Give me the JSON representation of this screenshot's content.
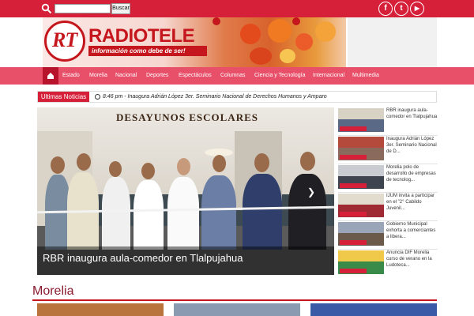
{
  "topbar": {
    "search_button_label": "Buscar",
    "search_value": "",
    "social": [
      {
        "icon": "facebook-icon",
        "glyph": "f"
      },
      {
        "icon": "twitter-icon",
        "glyph": "t"
      },
      {
        "icon": "youtube-icon",
        "glyph": "▶"
      }
    ]
  },
  "header": {
    "logo_initials": "RT",
    "logo_name": "RADIOTELE",
    "logo_tagline": "información como debe de ser!"
  },
  "nav": {
    "home_icon": "home-icon",
    "items": [
      "Estado",
      "Morelia",
      "Nacional",
      "Deportes",
      "Espectáculos",
      "Columnas",
      "Ciencia y Tecnología",
      "Internacional",
      "Multimedia"
    ]
  },
  "ticker": {
    "label": "Ultimas Noticias",
    "time": "8:46 pm",
    "separator": "-",
    "headline": "Inaugura Adrián López 3er. Seminario Nacional de Derechos Humanos y Amparo"
  },
  "hero": {
    "sign_text": "DESAYUNOS ESCOLARES",
    "caption": "RBR inaugura aula-comedor en Tlalpujahua",
    "next_icon": "chevron-right-icon"
  },
  "side_news": [
    {
      "title": "RBR inaugura aula-comedor en Tlalpujahua"
    },
    {
      "title": "Inaugura Adrián López 3er. Seminario Nacional de D..."
    },
    {
      "title": "Morelia polo de desarrollo de empresas de tecnolog..."
    },
    {
      "title": "IJUM invita a participar en el \"2° Cabildo Juvenil..."
    },
    {
      "title": "Gobierno Municipal exhorta a comerciantes a libera..."
    },
    {
      "title": "Anuncia DIF Morelia curso de verano en la Ludoteca..."
    }
  ],
  "section": {
    "title": "Morelia"
  },
  "colors": {
    "brand_red": "#d6203a",
    "nav_pink": "#e8506a",
    "section_title": "#8b1a2e"
  }
}
